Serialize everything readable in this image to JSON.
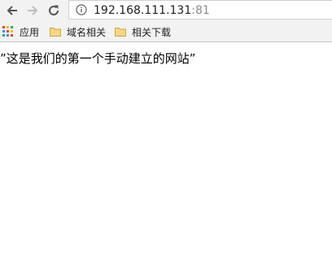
{
  "toolbar": {
    "back_icon": "arrow-left-icon",
    "forward_icon": "arrow-right-icon",
    "reload_icon": "reload-icon",
    "info_icon": "info-icon"
  },
  "address_bar": {
    "host": "192.168.111.131",
    "port": ":81"
  },
  "bookmarks": [
    {
      "label": "应用",
      "icon": "apps-grid-icon"
    },
    {
      "label": "域名相关",
      "icon": "folder-icon"
    },
    {
      "label": "相关下载",
      "icon": "folder-icon"
    }
  ],
  "page": {
    "text": "”这是我们的第一个手动建立的网站”"
  },
  "colors": {
    "toolbar_bg": "#f2f2f2",
    "folder": "#f5d77f",
    "url_host": "#222222",
    "url_port": "#8a8a8a"
  }
}
